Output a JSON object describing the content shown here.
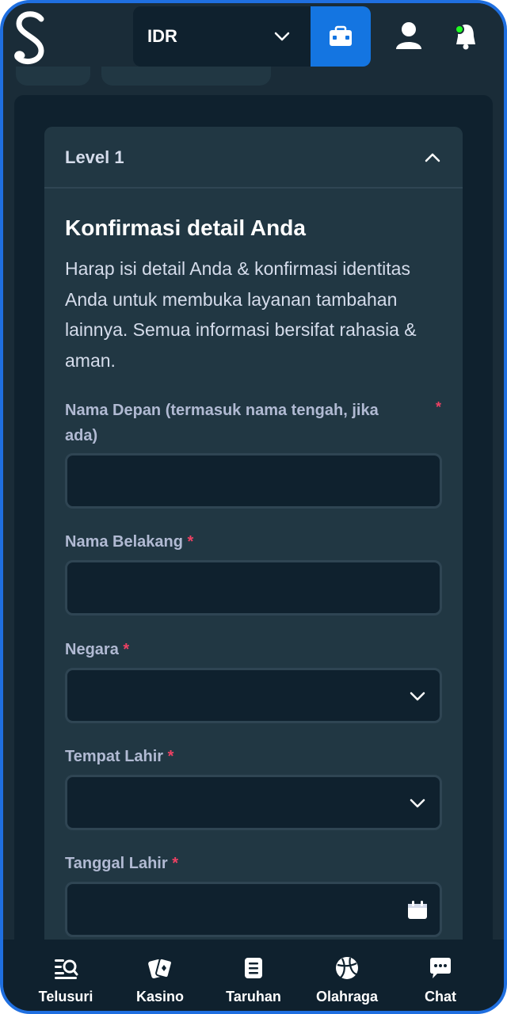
{
  "header": {
    "currency": "IDR"
  },
  "card": {
    "title": "Level 1",
    "section_title": "Konfirmasi detail Anda",
    "section_description": "Harap isi detail Anda & konfirmasi identitas Anda untuk membuka layanan tambahan lainnya. Semua informasi bersifat rahasia & aman."
  },
  "fields": {
    "first_name": {
      "label": "Nama Depan (termasuk nama tengah, jika ada)",
      "required_mark": "*",
      "value": ""
    },
    "last_name": {
      "label": "Nama Belakang",
      "required_mark": "*",
      "value": ""
    },
    "country": {
      "label": "Negara",
      "required_mark": "*",
      "value": ""
    },
    "birth_place": {
      "label": "Tempat Lahir",
      "required_mark": "*",
      "value": ""
    },
    "birth_date": {
      "label": "Tanggal Lahir",
      "required_mark": "*",
      "value": ""
    }
  },
  "bottom_nav": {
    "items": [
      {
        "label": "Telusuri",
        "icon": "search-list-icon"
      },
      {
        "label": "Kasino",
        "icon": "cards-icon"
      },
      {
        "label": "Taruhan",
        "icon": "betslip-icon"
      },
      {
        "label": "Olahraga",
        "icon": "ball-icon"
      },
      {
        "label": "Chat",
        "icon": "chat-icon"
      }
    ]
  },
  "colors": {
    "accent": "#1475e1",
    "background": "#1a2c38",
    "card": "#213743",
    "input": "#0f212e",
    "required": "#ed4163",
    "online": "#1fff20"
  }
}
